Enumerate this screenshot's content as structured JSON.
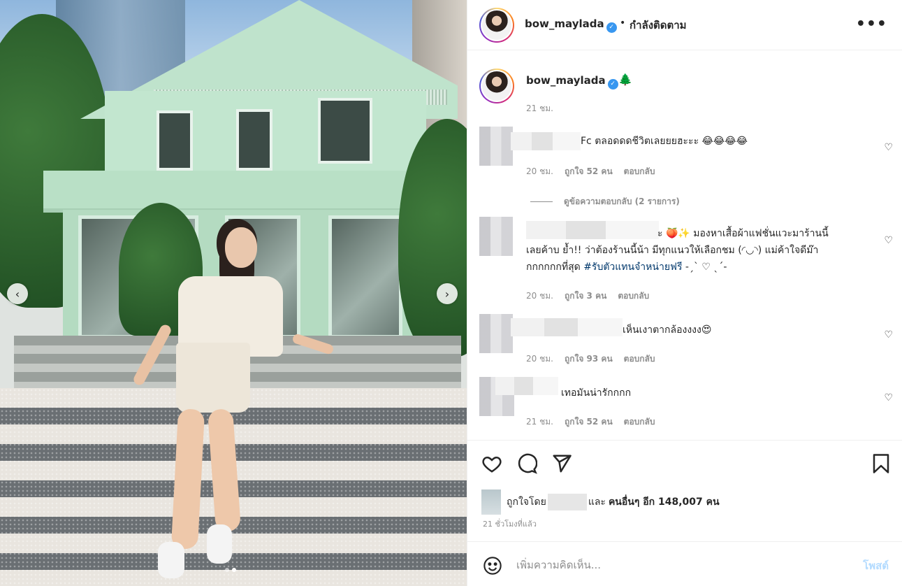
{
  "header": {
    "username": "bow_maylada",
    "separator": "•",
    "follow_status": "กำลังติดตาม",
    "more": "•••"
  },
  "caption": {
    "username": "bow_maylada",
    "emoji": "🌲",
    "time": "21 ชม."
  },
  "comments": [
    {
      "text": "Fc ตลอดดดชีวิตเลยยยฮะะะ 😂😂😂😂",
      "time": "20 ชม.",
      "likes": "ถูกใจ 52 คน",
      "reply": "ตอบกลับ"
    },
    {
      "view_replies": "ดูข้อความตอบกลับ (2 รายการ)"
    },
    {
      "line1": "ะ 🍑✨ มองหาเสื้อผ้าแฟชั่นแวะมาร้านนี้",
      "line2": "เลยค้าบ ย้ำ!! ว่าต้องร้านนี้น้า มีทุกแนวให้เลือกชม (◜◡◝) แม่ค้าใจดีม๊า",
      "line3_prefix": "กกกกกกที่สุด ",
      "hashtag": "#รับตัวแทนจำหน่ายฟรี",
      "line3_suffix": " -ˏˋ ♡ ˎˊ-",
      "time": "20 ชม.",
      "likes": "ถูกใจ 3 คน",
      "reply": "ตอบกลับ"
    },
    {
      "text": "เห็นเงาตากล้องงงง😍",
      "time": "20 ชม.",
      "likes": "ถูกใจ 93 คน",
      "reply": "ตอบกลับ"
    },
    {
      "text": "เทอมันน่ารักกกก",
      "time": "21 ชม.",
      "likes": "ถูกใจ 52 คน",
      "reply": "ตอบกลับ"
    }
  ],
  "likes": {
    "prefix": "ถูกใจโดย",
    "and": "และ",
    "others": "คนอื่นๆ อีก 148,007 คน"
  },
  "posted_ago": "21 ชั่วโมงที่แล้ว",
  "add_comment": {
    "placeholder": "เพิ่มความคิดเห็น...",
    "post_label": "โพสต์"
  },
  "carousel": {
    "prev": "‹",
    "next": "›",
    "slides": 2,
    "active_slide": 2
  },
  "icons": {
    "heart": "heart-icon",
    "comment": "comment-icon",
    "share": "share-icon",
    "save": "bookmark-icon",
    "emoji": "emoji-icon",
    "verified": "verified-badge-icon"
  },
  "colors": {
    "verified": "#3897f0",
    "muted": "#8e8e8e",
    "hashtag": "#00376b",
    "post_disabled": "#b3dbff"
  }
}
